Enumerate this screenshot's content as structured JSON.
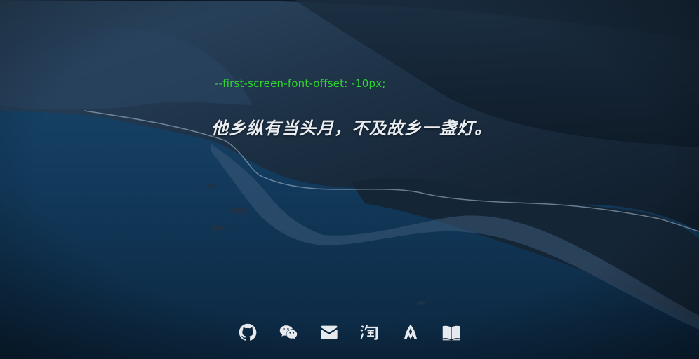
{
  "hero": {
    "code_text": "--first-screen-font-offset: -10px;",
    "headline": "他乡纵有当头月，不及故乡一盏灯。",
    "code_color": "#2fd62f",
    "headline_color": "#e9edf2"
  },
  "social_links": [
    {
      "icon": "github-icon"
    },
    {
      "icon": "wechat-icon"
    },
    {
      "icon": "mail-icon"
    },
    {
      "icon": "taobao-icon"
    },
    {
      "icon": "sketch-icon"
    },
    {
      "icon": "book-icon"
    }
  ],
  "background": {
    "description_colors": {
      "sky": "#0a1824",
      "sea": "#123454",
      "mountains": "#1f3a55"
    }
  }
}
